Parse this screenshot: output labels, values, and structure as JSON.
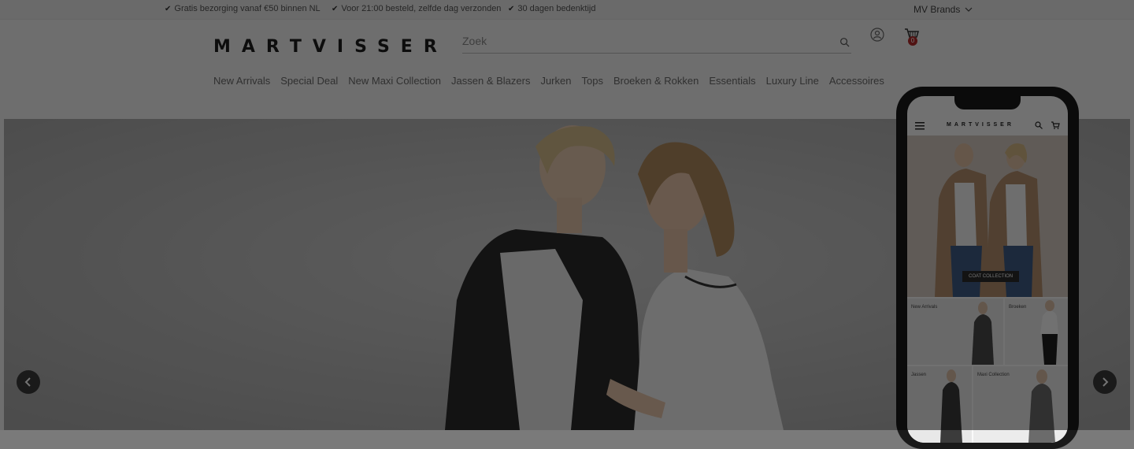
{
  "usp_bar": {
    "items": [
      "Gratis bezorging vanaf €50 binnen NL",
      "Voor 21:00 besteld, zelfde dag verzonden",
      "30 dagen bedenktijd"
    ],
    "brands_label": "MV Brands"
  },
  "header": {
    "logo": "MARTVISSER",
    "search_placeholder": "Zoek",
    "cart_count": "0"
  },
  "nav": {
    "items": [
      "New Arrivals",
      "Special Deal",
      "New Maxi Collection",
      "Jassen & Blazers",
      "Jurken",
      "Tops",
      "Broeken & Rokken",
      "Essentials",
      "Luxury Line",
      "Accessoires"
    ]
  },
  "phone": {
    "logo": "MARTVISSER",
    "hero_cta": "COAT COLLECTION",
    "tiles": [
      "New Arrivals",
      "Broeken",
      "Jassen",
      "Maxi Collection"
    ]
  },
  "colors": {
    "overlay": "#000000",
    "cart_badge": "#b42a2a",
    "accent_dark": "#1e1e1e"
  }
}
